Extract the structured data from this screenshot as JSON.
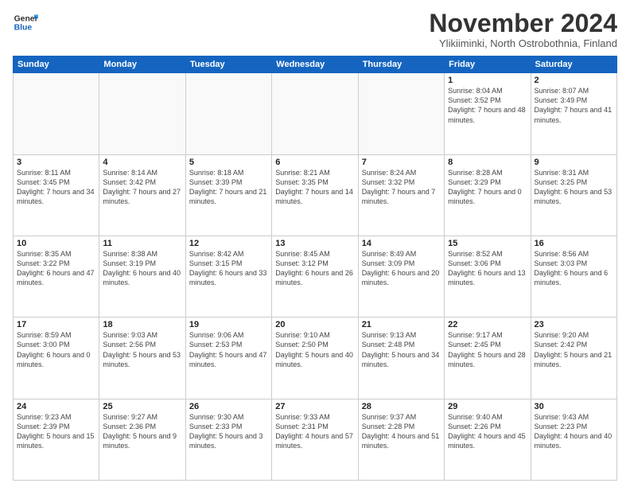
{
  "logo": {
    "line1": "General",
    "line2": "Blue"
  },
  "title": "November 2024",
  "subtitle": "Ylikiiminki, North Ostrobothnia, Finland",
  "weekdays": [
    "Sunday",
    "Monday",
    "Tuesday",
    "Wednesday",
    "Thursday",
    "Friday",
    "Saturday"
  ],
  "weeks": [
    [
      {
        "day": "",
        "info": ""
      },
      {
        "day": "",
        "info": ""
      },
      {
        "day": "",
        "info": ""
      },
      {
        "day": "",
        "info": ""
      },
      {
        "day": "",
        "info": ""
      },
      {
        "day": "1",
        "info": "Sunrise: 8:04 AM\nSunset: 3:52 PM\nDaylight: 7 hours\nand 48 minutes."
      },
      {
        "day": "2",
        "info": "Sunrise: 8:07 AM\nSunset: 3:49 PM\nDaylight: 7 hours\nand 41 minutes."
      }
    ],
    [
      {
        "day": "3",
        "info": "Sunrise: 8:11 AM\nSunset: 3:45 PM\nDaylight: 7 hours\nand 34 minutes."
      },
      {
        "day": "4",
        "info": "Sunrise: 8:14 AM\nSunset: 3:42 PM\nDaylight: 7 hours\nand 27 minutes."
      },
      {
        "day": "5",
        "info": "Sunrise: 8:18 AM\nSunset: 3:39 PM\nDaylight: 7 hours\nand 21 minutes."
      },
      {
        "day": "6",
        "info": "Sunrise: 8:21 AM\nSunset: 3:35 PM\nDaylight: 7 hours\nand 14 minutes."
      },
      {
        "day": "7",
        "info": "Sunrise: 8:24 AM\nSunset: 3:32 PM\nDaylight: 7 hours\nand 7 minutes."
      },
      {
        "day": "8",
        "info": "Sunrise: 8:28 AM\nSunset: 3:29 PM\nDaylight: 7 hours\nand 0 minutes."
      },
      {
        "day": "9",
        "info": "Sunrise: 8:31 AM\nSunset: 3:25 PM\nDaylight: 6 hours\nand 53 minutes."
      }
    ],
    [
      {
        "day": "10",
        "info": "Sunrise: 8:35 AM\nSunset: 3:22 PM\nDaylight: 6 hours\nand 47 minutes."
      },
      {
        "day": "11",
        "info": "Sunrise: 8:38 AM\nSunset: 3:19 PM\nDaylight: 6 hours\nand 40 minutes."
      },
      {
        "day": "12",
        "info": "Sunrise: 8:42 AM\nSunset: 3:15 PM\nDaylight: 6 hours\nand 33 minutes."
      },
      {
        "day": "13",
        "info": "Sunrise: 8:45 AM\nSunset: 3:12 PM\nDaylight: 6 hours\nand 26 minutes."
      },
      {
        "day": "14",
        "info": "Sunrise: 8:49 AM\nSunset: 3:09 PM\nDaylight: 6 hours\nand 20 minutes."
      },
      {
        "day": "15",
        "info": "Sunrise: 8:52 AM\nSunset: 3:06 PM\nDaylight: 6 hours\nand 13 minutes."
      },
      {
        "day": "16",
        "info": "Sunrise: 8:56 AM\nSunset: 3:03 PM\nDaylight: 6 hours\nand 6 minutes."
      }
    ],
    [
      {
        "day": "17",
        "info": "Sunrise: 8:59 AM\nSunset: 3:00 PM\nDaylight: 6 hours\nand 0 minutes."
      },
      {
        "day": "18",
        "info": "Sunrise: 9:03 AM\nSunset: 2:56 PM\nDaylight: 5 hours\nand 53 minutes."
      },
      {
        "day": "19",
        "info": "Sunrise: 9:06 AM\nSunset: 2:53 PM\nDaylight: 5 hours\nand 47 minutes."
      },
      {
        "day": "20",
        "info": "Sunrise: 9:10 AM\nSunset: 2:50 PM\nDaylight: 5 hours\nand 40 minutes."
      },
      {
        "day": "21",
        "info": "Sunrise: 9:13 AM\nSunset: 2:48 PM\nDaylight: 5 hours\nand 34 minutes."
      },
      {
        "day": "22",
        "info": "Sunrise: 9:17 AM\nSunset: 2:45 PM\nDaylight: 5 hours\nand 28 minutes."
      },
      {
        "day": "23",
        "info": "Sunrise: 9:20 AM\nSunset: 2:42 PM\nDaylight: 5 hours\nand 21 minutes."
      }
    ],
    [
      {
        "day": "24",
        "info": "Sunrise: 9:23 AM\nSunset: 2:39 PM\nDaylight: 5 hours\nand 15 minutes."
      },
      {
        "day": "25",
        "info": "Sunrise: 9:27 AM\nSunset: 2:36 PM\nDaylight: 5 hours\nand 9 minutes."
      },
      {
        "day": "26",
        "info": "Sunrise: 9:30 AM\nSunset: 2:33 PM\nDaylight: 5 hours\nand 3 minutes."
      },
      {
        "day": "27",
        "info": "Sunrise: 9:33 AM\nSunset: 2:31 PM\nDaylight: 4 hours\nand 57 minutes."
      },
      {
        "day": "28",
        "info": "Sunrise: 9:37 AM\nSunset: 2:28 PM\nDaylight: 4 hours\nand 51 minutes."
      },
      {
        "day": "29",
        "info": "Sunrise: 9:40 AM\nSunset: 2:26 PM\nDaylight: 4 hours\nand 45 minutes."
      },
      {
        "day": "30",
        "info": "Sunrise: 9:43 AM\nSunset: 2:23 PM\nDaylight: 4 hours\nand 40 minutes."
      }
    ]
  ]
}
